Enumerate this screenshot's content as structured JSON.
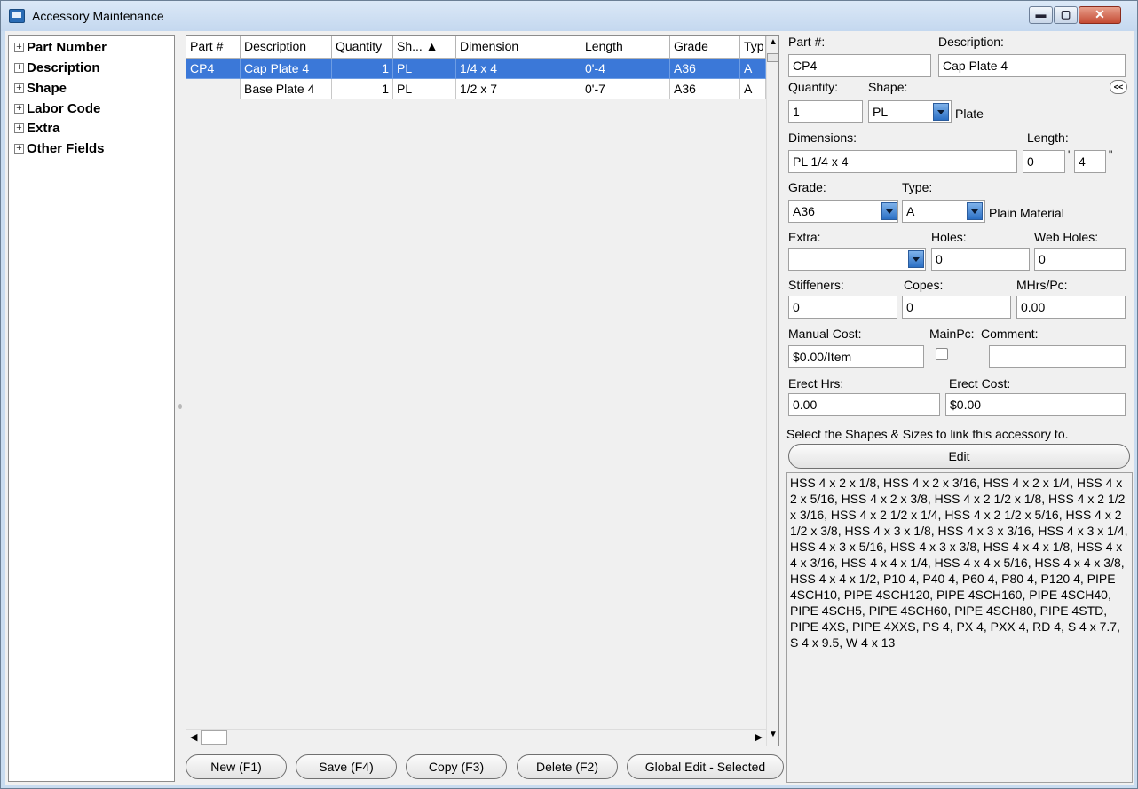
{
  "window": {
    "title": "Accessory Maintenance"
  },
  "tree": {
    "items": [
      {
        "label": "Part Number"
      },
      {
        "label": "Description"
      },
      {
        "label": "Shape"
      },
      {
        "label": "Labor Code"
      },
      {
        "label": "Extra"
      },
      {
        "label": "Other Fields"
      }
    ]
  },
  "grid": {
    "headers": [
      "Part #",
      "Description",
      "Quantity",
      "Sh... ▲",
      "Dimension",
      "Length",
      "Grade",
      "Typ"
    ],
    "rows": [
      {
        "part": "CP4",
        "description": "Cap Plate 4",
        "quantity": "1",
        "shape": "PL",
        "dimension": "1/4 x 4",
        "length": "0'-4",
        "grade": "A36",
        "type": "A",
        "selected": true
      },
      {
        "part": "",
        "description": "Base Plate 4",
        "quantity": "1",
        "shape": "PL",
        "dimension": "1/2 x 7",
        "length": "0'-7",
        "grade": "A36",
        "type": "A",
        "selected": false
      }
    ]
  },
  "buttons": {
    "new": "New (F1)",
    "save": "Save (F4)",
    "copy": "Copy (F3)",
    "delete": "Delete (F2)",
    "global_edit": "Global Edit - Selected"
  },
  "form": {
    "part_label": "Part #:",
    "part_value": "CP4",
    "desc_label": "Description:",
    "desc_value": "Cap Plate 4",
    "collapse": "<<",
    "qty_label": "Quantity:",
    "qty_value": "1",
    "shape_label": "Shape:",
    "shape_value": "PL",
    "shape_name": "Plate",
    "dim_label": "Dimensions:",
    "dim_value": "PL 1/4 x 4",
    "length_label": "Length:",
    "length_ft": "0",
    "length_ft_unit": "'",
    "length_in": "4",
    "length_in_unit": "\"",
    "grade_label": "Grade:",
    "grade_value": "A36",
    "type_label": "Type:",
    "type_value": "A",
    "type_name": "Plain Material",
    "extra_label": "Extra:",
    "extra_value": "",
    "holes_label": "Holes:",
    "holes_value": "0",
    "webholes_label": "Web Holes:",
    "webholes_value": "0",
    "stiff_label": "Stiffeners:",
    "stiff_value": "0",
    "copes_label": "Copes:",
    "copes_value": "0",
    "mhrs_label": "MHrs/Pc:",
    "mhrs_value": "0.00",
    "manual_label": "Manual Cost:",
    "manual_value": "$0.00/Item",
    "mainpc_label": "MainPc:",
    "mainpc_checked": false,
    "comment_label": "Comment:",
    "comment_value": "",
    "erect_hrs_label": "Erect Hrs:",
    "erect_hrs_value": "0.00",
    "erect_cost_label": "Erect Cost:",
    "erect_cost_value": "$0.00",
    "link_instructions": "Select the Shapes & Sizes to link this accessory to.",
    "edit_button": "Edit",
    "linked_shapes": "HSS 4 x 2 x 1/8, HSS 4 x 2 x 3/16, HSS 4 x 2 x 1/4, HSS 4 x 2 x 5/16, HSS 4 x 2 x 3/8, HSS 4 x 2 1/2 x 1/8, HSS 4 x 2 1/2 x 3/16, HSS 4 x 2 1/2 x 1/4, HSS 4 x 2 1/2 x 5/16, HSS 4 x 2 1/2 x 3/8, HSS 4 x 3 x 1/8, HSS 4 x 3 x 3/16, HSS 4 x 3 x 1/4, HSS 4 x 3 x 5/16, HSS 4 x 3 x 3/8, HSS 4 x 4 x 1/8, HSS 4 x 4 x 3/16, HSS 4 x 4 x 1/4, HSS 4 x 4 x 5/16, HSS 4 x 4 x 3/8, HSS 4 x 4 x 1/2, P10 4, P40 4, P60 4, P80 4, P120 4, PIPE 4SCH10, PIPE 4SCH120, PIPE 4SCH160, PIPE 4SCH40, PIPE 4SCH5, PIPE 4SCH60, PIPE 4SCH80, PIPE 4STD, PIPE 4XS, PIPE 4XXS, PS 4, PX 4, PXX 4, RD 4, S 4 x 7.7, S 4 x 9.5, W 4 x 13"
  }
}
